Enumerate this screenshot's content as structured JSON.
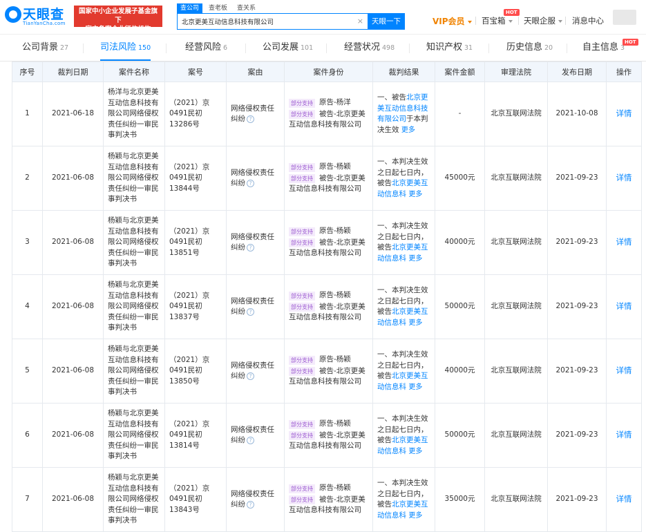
{
  "header": {
    "logo_text": "天眼查",
    "logo_sub": "TianYanCha.com",
    "badge_line1": "国家中小企业发展子基金旗下",
    "badge_line2": "官方备案企业征信机构",
    "search_tabs": [
      "查公司",
      "查老板",
      "查关系"
    ],
    "search_value": "北京更美互动信息科技有限公司",
    "search_button": "天眼一下",
    "vip_label": "VIP会员",
    "baobao_label": "百宝箱",
    "hot_label": "HOT",
    "service_label": "天眼企服",
    "message_label": "消息中心"
  },
  "tabs": [
    {
      "label": "公司背景",
      "count": "27"
    },
    {
      "label": "司法风险",
      "count": "150"
    },
    {
      "label": "经营风险",
      "count": "6"
    },
    {
      "label": "公司发展",
      "count": "101"
    },
    {
      "label": "经营状况",
      "count": "498"
    },
    {
      "label": "知识产权",
      "count": "31"
    },
    {
      "label": "历史信息",
      "count": "20"
    },
    {
      "label": "自主信息",
      "count": "3"
    }
  ],
  "table": {
    "columns": [
      "序号",
      "裁判日期",
      "案件名称",
      "案号",
      "案由",
      "案件身份",
      "裁判结果",
      "案件金额",
      "审理法院",
      "发布日期",
      "操作"
    ],
    "tag_label": "部分支持",
    "cause_text": "网络侵权责任纠纷",
    "court": "北京互联网法院",
    "detail_label": "详情",
    "more_label": "更多",
    "rows": [
      {
        "no": "1",
        "date": "2021-06-18",
        "name": "杨洋与北京更美互动信息科技有限公司网络侵权责任纠纷一审民事判决书",
        "case_no": "（2021）京0491民初13286号",
        "plaintiff": "原告-杨洋",
        "defendant": "被告-北京更美互动信息科技有限公司",
        "result_pre": "一、被告",
        "result_link": "北京更美互动信息科技有限公司",
        "result_post": "于本判决生效",
        "amount": "-",
        "pub_date": "2021-10-08"
      },
      {
        "no": "2",
        "date": "2021-06-08",
        "name": "杨颖与北京更美互动信息科技有限公司网络侵权责任纠纷一审民事判决书",
        "case_no": "（2021）京0491民初13844号",
        "plaintiff": "原告-杨颖",
        "defendant": "被告-北京更美互动信息科技有限公司",
        "result_pre": "一、本判决生效之日起七日内，被告",
        "result_link": "北京更美互动信息科",
        "result_post": "",
        "amount": "45000元",
        "pub_date": "2021-09-23"
      },
      {
        "no": "3",
        "date": "2021-06-08",
        "name": "杨颖与北京更美互动信息科技有限公司网络侵权责任纠纷一审民事判决书",
        "case_no": "（2021）京0491民初13851号",
        "plaintiff": "原告-杨颖",
        "defendant": "被告-北京更美互动信息科技有限公司",
        "result_pre": "一、本判决生效之日起七日内，被告",
        "result_link": "北京更美互动信息科",
        "result_post": "",
        "amount": "40000元",
        "pub_date": "2021-09-23"
      },
      {
        "no": "4",
        "date": "2021-06-08",
        "name": "杨颖与北京更美互动信息科技有限公司网络侵权责任纠纷一审民事判决书",
        "case_no": "（2021）京0491民初13837号",
        "plaintiff": "原告-杨颖",
        "defendant": "被告-北京更美互动信息科技有限公司",
        "result_pre": "一、本判决生效之日起七日内，被告",
        "result_link": "北京更美互动信息科",
        "result_post": "",
        "amount": "50000元",
        "pub_date": "2021-09-23"
      },
      {
        "no": "5",
        "date": "2021-06-08",
        "name": "杨颖与北京更美互动信息科技有限公司网络侵权责任纠纷一审民事判决书",
        "case_no": "（2021）京0491民初13850号",
        "plaintiff": "原告-杨颖",
        "defendant": "被告-北京更美互动信息科技有限公司",
        "result_pre": "一、本判决生效之日起七日内，被告",
        "result_link": "北京更美互动信息科",
        "result_post": "",
        "amount": "40000元",
        "pub_date": "2021-09-23"
      },
      {
        "no": "6",
        "date": "2021-06-08",
        "name": "杨颖与北京更美互动信息科技有限公司网络侵权责任纠纷一审民事判决书",
        "case_no": "（2021）京0491民初13814号",
        "plaintiff": "原告-杨颖",
        "defendant": "被告-北京更美互动信息科技有限公司",
        "result_pre": "一、本判决生效之日起七日内，被告",
        "result_link": "北京更美互动信息科",
        "result_post": "",
        "amount": "50000元",
        "pub_date": "2021-09-23"
      },
      {
        "no": "7",
        "date": "2021-06-08",
        "name": "杨颖与北京更美互动信息科技有限公司网络侵权责任纠纷一审民事判决书",
        "case_no": "（2021）京0491民初13843号",
        "plaintiff": "原告-杨颖",
        "defendant": "被告-北京更美互动信息科技有限公司",
        "result_pre": "一、本判决生效之日起七日内，被告",
        "result_link": "北京更美互动信息科",
        "result_post": "",
        "amount": "35000元",
        "pub_date": "2021-09-23"
      }
    ]
  }
}
